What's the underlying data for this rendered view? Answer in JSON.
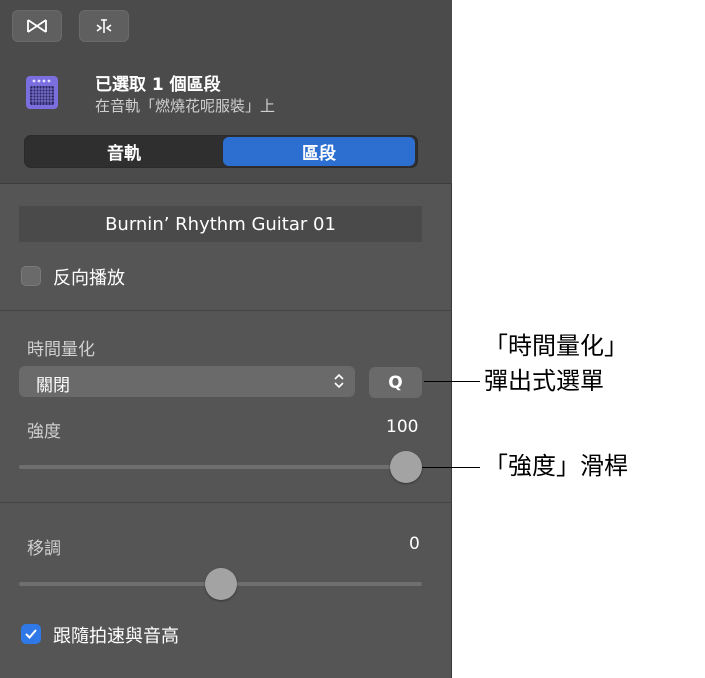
{
  "toolbar": {
    "btn1_icon": "bowtie-icon",
    "btn2_icon": "flex-marker-icon"
  },
  "header": {
    "title": "已選取 1 個區段",
    "subtitle": "在音軌「燃燒花呢服裝」上",
    "icon": "amp-icon"
  },
  "tabs": [
    {
      "label": "音軌",
      "selected": false
    },
    {
      "label": "區段",
      "selected": true
    }
  ],
  "region": {
    "name": "Burnin’ Rhythm Guitar 01",
    "reverse_label": "反向播放",
    "reverse_checked": false
  },
  "quantize": {
    "section_label": "時間量化",
    "value": "關閉",
    "q_button": "Q",
    "strength_label": "強度",
    "strength_value": "100",
    "strength_fraction": 1.0
  },
  "transpose": {
    "label": "移調",
    "value": "0",
    "fraction": 0.5,
    "follow_label": "跟隨拍速與音高",
    "follow_checked": true
  },
  "callouts": {
    "popup_line1": "「時間量化」",
    "popup_line2": "彈出式選單",
    "slider": "「強度」滑桿"
  },
  "colors": {
    "accent": "#2c6fd0",
    "panel": "#555555"
  }
}
